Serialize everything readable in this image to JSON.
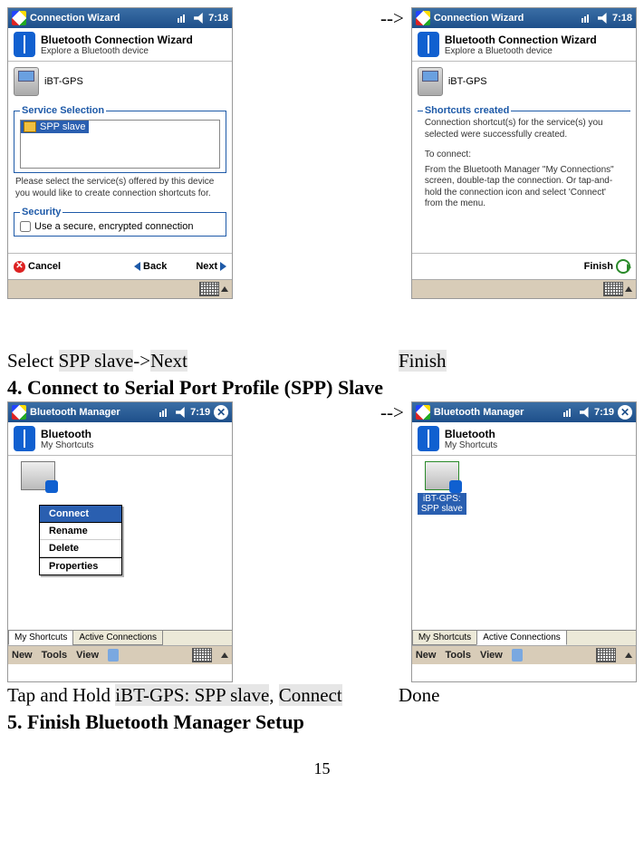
{
  "arrow": "-->",
  "screens": {
    "s1": {
      "app": "Connection Wizard",
      "time": "7:18",
      "header_title": "Bluetooth Connection Wizard",
      "header_sub": "Explore a Bluetooth device",
      "device": "iBT-GPS",
      "section1": "Service Selection",
      "list_item": "SPP slave",
      "hint": "Please select the service(s) offered by this device you would like to create connection shortcuts for.",
      "section2": "Security",
      "checkbox": "Use a secure, encrypted connection",
      "cancel": "Cancel",
      "back": "Back",
      "next": "Next"
    },
    "s2": {
      "app": "Connection Wizard",
      "time": "7:18",
      "header_title": "Bluetooth Connection Wizard",
      "header_sub": "Explore a Bluetooth device",
      "device": "iBT-GPS",
      "section1": "Shortcuts created",
      "msg1": "Connection shortcut(s) for the service(s) you selected were successfully created.",
      "msg2": "To connect:",
      "msg3": "From the Bluetooth Manager \"My Connections\" screen, double-tap the connection. Or tap-and-hold the connection icon and select 'Connect' from the menu.",
      "finish": "Finish"
    },
    "s3": {
      "app": "Bluetooth Manager",
      "time": "7:19",
      "header_title": "Bluetooth",
      "header_sub": "My Shortcuts",
      "ctx": {
        "connect": "Connect",
        "rename": "Rename",
        "delete": "Delete",
        "properties": "Properties"
      },
      "tabs": {
        "my": "My Shortcuts",
        "active": "Active Connections"
      },
      "menu": {
        "new": "New",
        "tools": "Tools",
        "view": "View"
      }
    },
    "s4": {
      "app": "Bluetooth Manager",
      "time": "7:19",
      "header_title": "Bluetooth",
      "header_sub": "My Shortcuts",
      "shortcut_line1": "iBT-GPS:",
      "shortcut_line2": "SPP slave",
      "tabs": {
        "my": "My Shortcuts",
        "active": "Active Connections"
      },
      "menu": {
        "new": "New",
        "tools": "Tools",
        "view": "View"
      }
    }
  },
  "captions": {
    "c1_a": "Select ",
    "c1_b": "SPP slave",
    "c1_c": "->",
    "c1_d": "Next",
    "c2": "Finish",
    "h4": "4. Connect to Serial Port Profile (SPP) Slave",
    "c3_a": "Tap and Hold ",
    "c3_b": "iBT-GPS: SPP slave",
    "c3_c": ", ",
    "c3_d": "Connect",
    "c4": "Done",
    "h5": "5. Finish Bluetooth Manager Setup"
  },
  "page": "15"
}
